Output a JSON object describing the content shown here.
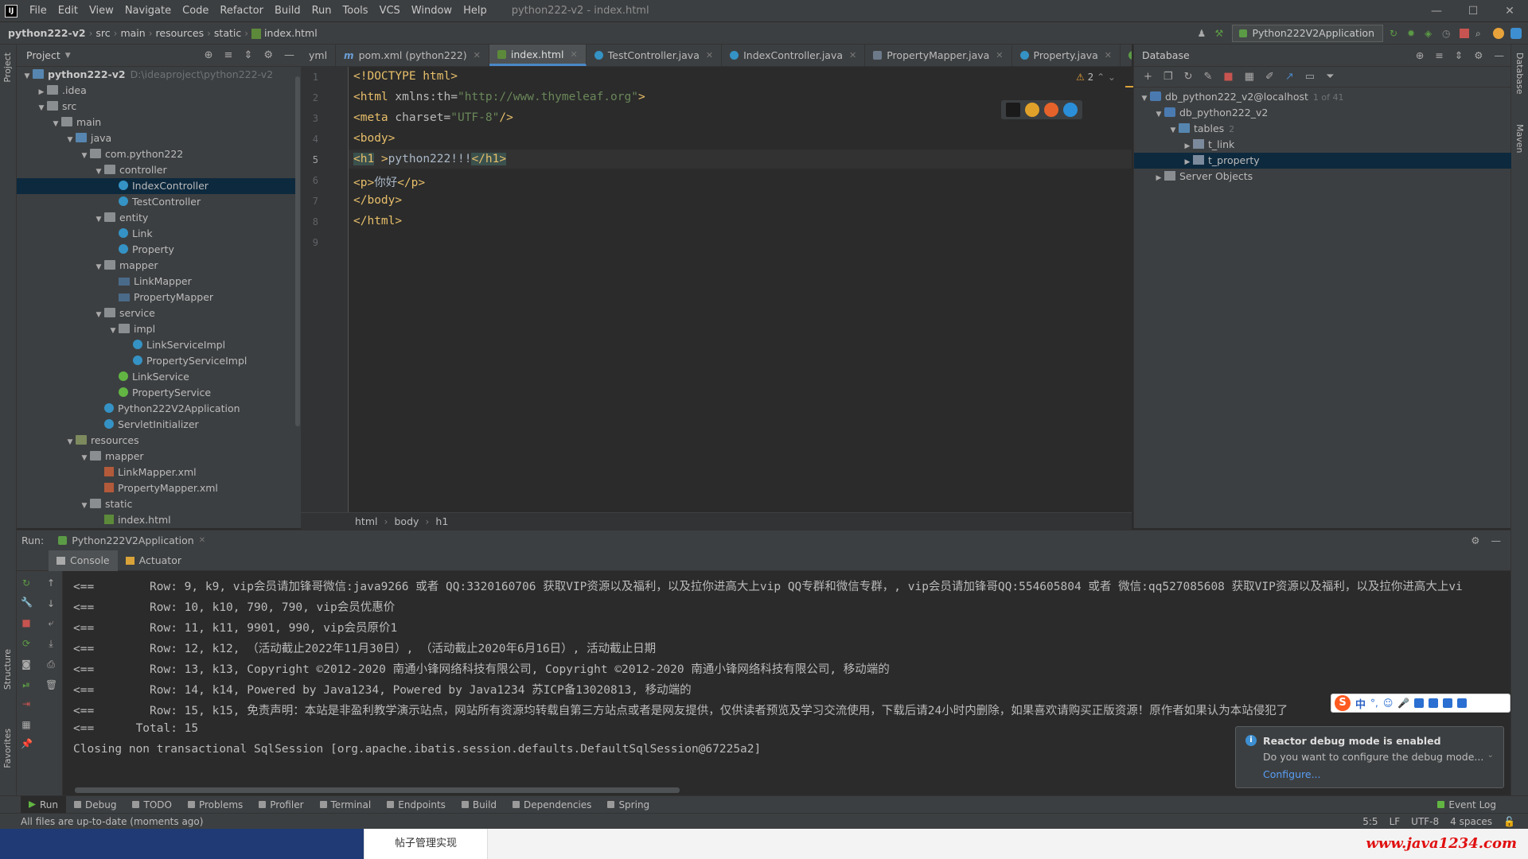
{
  "menu": {
    "items": [
      "File",
      "Edit",
      "View",
      "Navigate",
      "Code",
      "Refactor",
      "Build",
      "Run",
      "Tools",
      "VCS",
      "Window",
      "Help"
    ],
    "window_title": "python222-v2 - index.html"
  },
  "nav": {
    "crumbs": [
      "python222-v2",
      "src",
      "main",
      "resources",
      "static",
      "index.html"
    ],
    "run_config": "Python222V2Application"
  },
  "project": {
    "title": "Project",
    "tree": [
      {
        "indent": 0,
        "arrow": "▼",
        "icon": "folder blue",
        "name": "python222-v2",
        "bold": true,
        "path": "D:\\ideaproject\\python222-v2"
      },
      {
        "indent": 1,
        "arrow": "▶",
        "icon": "folder",
        "name": ".idea"
      },
      {
        "indent": 1,
        "arrow": "▼",
        "icon": "folder",
        "name": "src"
      },
      {
        "indent": 2,
        "arrow": "▼",
        "icon": "folder",
        "name": "main"
      },
      {
        "indent": 3,
        "arrow": "▼",
        "icon": "folder blue",
        "name": "java"
      },
      {
        "indent": 4,
        "arrow": "▼",
        "icon": "folder",
        "name": "com.python222"
      },
      {
        "indent": 5,
        "arrow": "▼",
        "icon": "folder",
        "name": "controller"
      },
      {
        "indent": 6,
        "arrow": "",
        "icon": "cls",
        "name": "IndexController",
        "selected": true
      },
      {
        "indent": 6,
        "arrow": "",
        "icon": "cls",
        "name": "TestController"
      },
      {
        "indent": 5,
        "arrow": "▼",
        "icon": "folder",
        "name": "entity"
      },
      {
        "indent": 6,
        "arrow": "",
        "icon": "cls",
        "name": "Link"
      },
      {
        "indent": 6,
        "arrow": "",
        "icon": "cls",
        "name": "Property"
      },
      {
        "indent": 5,
        "arrow": "▼",
        "icon": "folder",
        "name": "mapper"
      },
      {
        "indent": 6,
        "arrow": "",
        "icon": "mapper",
        "name": "LinkMapper"
      },
      {
        "indent": 6,
        "arrow": "",
        "icon": "mapper",
        "name": "PropertyMapper"
      },
      {
        "indent": 5,
        "arrow": "▼",
        "icon": "folder",
        "name": "service"
      },
      {
        "indent": 6,
        "arrow": "▼",
        "icon": "folder",
        "name": "impl"
      },
      {
        "indent": 7,
        "arrow": "",
        "icon": "cls",
        "name": "LinkServiceImpl"
      },
      {
        "indent": 7,
        "arrow": "",
        "icon": "cls",
        "name": "PropertyServiceImpl"
      },
      {
        "indent": 6,
        "arrow": "",
        "icon": "intf",
        "name": "LinkService"
      },
      {
        "indent": 6,
        "arrow": "",
        "icon": "intf",
        "name": "PropertyService"
      },
      {
        "indent": 5,
        "arrow": "",
        "icon": "cls",
        "name": "Python222V2Application"
      },
      {
        "indent": 5,
        "arrow": "",
        "icon": "cls",
        "name": "ServletInitializer"
      },
      {
        "indent": 3,
        "arrow": "▼",
        "icon": "folder res",
        "name": "resources"
      },
      {
        "indent": 4,
        "arrow": "▼",
        "icon": "folder",
        "name": "mapper"
      },
      {
        "indent": 5,
        "arrow": "",
        "icon": "xml",
        "name": "LinkMapper.xml"
      },
      {
        "indent": 5,
        "arrow": "",
        "icon": "xml",
        "name": "PropertyMapper.xml"
      },
      {
        "indent": 4,
        "arrow": "▼",
        "icon": "folder",
        "name": "static"
      },
      {
        "indent": 5,
        "arrow": "",
        "icon": "html",
        "name": "index.html"
      }
    ]
  },
  "tabs": [
    {
      "label": "yml",
      "icon": "",
      "partial": true
    },
    {
      "label": "pom.xml (python222)",
      "icon": "m"
    },
    {
      "label": "index.html",
      "icon": "h",
      "active": true
    },
    {
      "label": "TestController.java",
      "icon": "c"
    },
    {
      "label": "IndexController.java",
      "icon": "c"
    },
    {
      "label": "PropertyMapper.java",
      "icon": "p"
    },
    {
      "label": "Property.java",
      "icon": "c"
    },
    {
      "label": "applic",
      "icon": "a",
      "partial": true
    }
  ],
  "editor": {
    "warning_count": "2",
    "current_line": 5,
    "lines": [
      [
        {
          "t": "<!DOCTYPE html>",
          "c": "tag"
        }
      ],
      [
        {
          "t": "<html",
          "c": "tag"
        },
        {
          "t": " xmlns:th=",
          "c": "attr"
        },
        {
          "t": "\"http://www.thymeleaf.org\"",
          "c": "str"
        },
        {
          "t": ">",
          "c": "tag"
        }
      ],
      [
        {
          "t": "<meta",
          "c": "tag"
        },
        {
          "t": " charset=",
          "c": "attr"
        },
        {
          "t": "\"UTF-8\"",
          "c": "str"
        },
        {
          "t": "/>",
          "c": "tag"
        }
      ],
      [
        {
          "t": "<body>",
          "c": "tag"
        }
      ],
      [
        {
          "t": "<h1",
          "c": "tag box"
        },
        {
          "t": " >",
          "c": "tag"
        },
        {
          "t": "python222!!!",
          "c": "txt"
        },
        {
          "t": "</h1>",
          "c": "tag box"
        }
      ],
      [
        {
          "t": "<p>",
          "c": "tag"
        },
        {
          "t": "你好",
          "c": "txt"
        },
        {
          "t": "</p>",
          "c": "tag"
        }
      ],
      [
        {
          "t": "</body>",
          "c": "tag"
        }
      ],
      [
        {
          "t": "</html>",
          "c": "tag"
        }
      ],
      []
    ],
    "breadcrumbs": [
      "html",
      "body",
      "h1"
    ]
  },
  "database": {
    "title": "Database",
    "tree": [
      {
        "indent": 0,
        "arrow": "▼",
        "icon": "db",
        "name": "db_python222_v2@localhost",
        "count": "1 of 41"
      },
      {
        "indent": 1,
        "arrow": "▼",
        "icon": "db",
        "name": "db_python222_v2"
      },
      {
        "indent": 2,
        "arrow": "▼",
        "icon": "folder blue",
        "name": "tables",
        "count": "2"
      },
      {
        "indent": 3,
        "arrow": "▶",
        "icon": "table",
        "name": "t_link"
      },
      {
        "indent": 3,
        "arrow": "▶",
        "icon": "table",
        "name": "t_property",
        "selected": true
      },
      {
        "indent": 1,
        "arrow": "▶",
        "icon": "srv",
        "name": "Server Objects"
      }
    ]
  },
  "run": {
    "label": "Run:",
    "config": "Python222V2Application",
    "subtabs": [
      "Console",
      "Actuator"
    ],
    "console": [
      "<==        Row: 9, k9, vip会员请加锋哥微信:java9266 或者 QQ:3320160706 获取VIP资源以及福利，以及拉你进高大上vip QQ专群和微信专群，, vip会员请加锋哥QQ:554605804 或者 微信:qq527085608 获取VIP资源以及福利，以及拉你进高大上vi",
      "<==        Row: 10, k10, 790, 790, vip会员优惠价",
      "<==        Row: 11, k11, 9901, 990, vip会员原价1",
      "<==        Row: 12, k12, （活动截止2022年11月30日）, （活动截止2020年6月16日）, 活动截止日期",
      "<==        Row: 13, k13, Copyright ©2012-2020 南通小锋网络科技有限公司, Copyright ©2012-2020 南通小锋网络科技有限公司, 移动端的",
      "<==        Row: 14, k14, Powered by Java1234, Powered by Java1234 苏ICP备13020813, 移动端的",
      "<==        Row: 15, k15, 免责声明：本站是非盈利教学演示站点，网站所有资源均转载自第三方站点或者是网友提供，仅供读者预览及学习交流使用，下载后请24小时内删除，如果喜欢请购买正版资源！原作者如果认为本站侵犯了",
      "<==      Total: 15",
      "Closing non transactional SqlSession [org.apache.ibatis.session.defaults.DefaultSqlSession@67225a2]"
    ]
  },
  "notification": {
    "title": "Reactor debug mode is enabled",
    "body": "Do you want to configure the debug mode...",
    "link": "Configure..."
  },
  "ime": {
    "zh": "中"
  },
  "bottom_tools": [
    "Run",
    "Debug",
    "TODO",
    "Problems",
    "Profiler",
    "Terminal",
    "Endpoints",
    "Build",
    "Dependencies",
    "Spring"
  ],
  "event_log": "Event Log",
  "status": {
    "message": "All files are up-to-date (moments ago)",
    "position": "5:5",
    "line_sep": "LF",
    "encoding": "UTF-8",
    "indent": "4 spaces"
  },
  "left_strip": [
    "Project",
    "Structure",
    "Favorites"
  ],
  "right_strip": [
    "Database",
    "Maven"
  ],
  "taskbar": {
    "item": "帖子管理实现",
    "watermark": "www.java1234.com"
  },
  "colors": {
    "accent": "#4a88c7",
    "selection": "#0d293e",
    "tag": "#e8bf6a",
    "string": "#6a8759"
  }
}
